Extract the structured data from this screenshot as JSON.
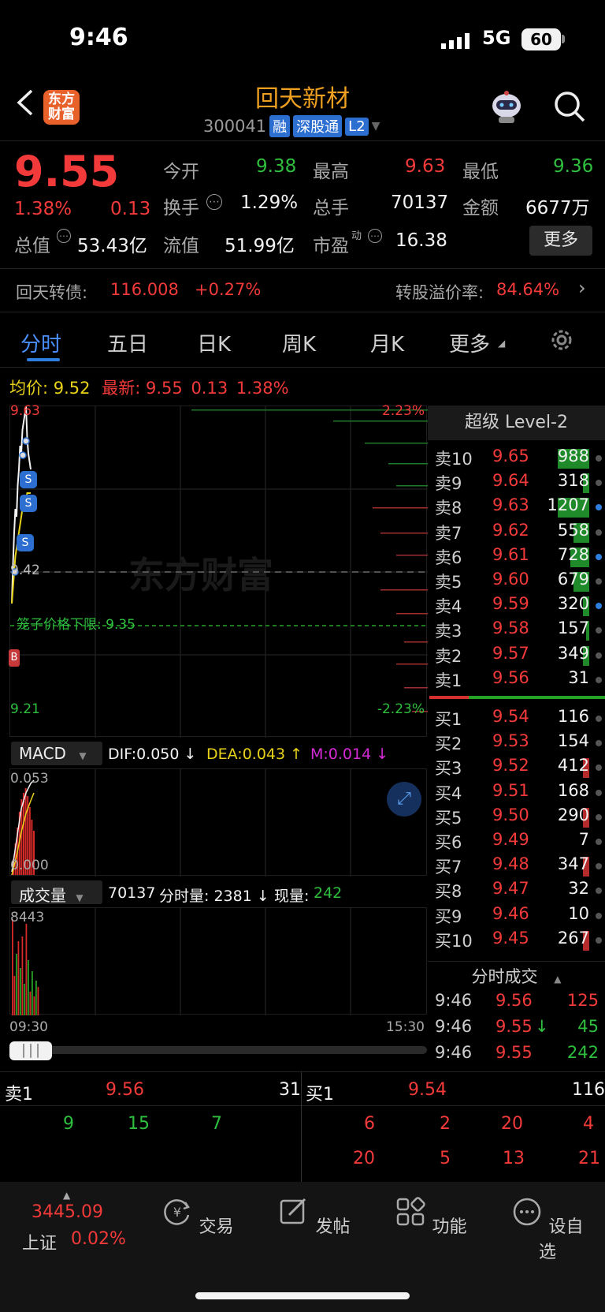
{
  "status": {
    "time": "9:46",
    "network": "5G",
    "battery": "60"
  },
  "header": {
    "title": "回天新材",
    "code": "300041",
    "tags": [
      "融",
      "深股通",
      "L2"
    ],
    "logo_text": "东方财富"
  },
  "quote": {
    "price": "9.55",
    "change_pct": "1.38%",
    "change": "0.13",
    "rows": [
      [
        {
          "k": "今开",
          "v": "9.38",
          "c": "green"
        },
        {
          "k": "最高",
          "v": "9.63",
          "c": "red"
        },
        {
          "k": "最低",
          "v": "9.36",
          "c": "green"
        }
      ],
      [
        {
          "k": "换手",
          "v": "1.29%",
          "c": "white"
        },
        {
          "k": "总手",
          "v": "70137",
          "c": "white"
        },
        {
          "k": "金额",
          "v": "6677万",
          "c": "white"
        }
      ],
      [
        {
          "k": "总值",
          "v": "53.43亿",
          "c": "white"
        },
        {
          "k": "流值",
          "v": "51.99亿",
          "c": "white"
        },
        {
          "k": "市盈",
          "v": "16.38",
          "c": "white"
        }
      ]
    ],
    "pe_sup": "动",
    "more_label": "更多"
  },
  "bond": {
    "name": "回天转债:",
    "price": "116.008",
    "pct": "+0.27%",
    "premium_label": "转股溢价率:",
    "premium": "84.64%"
  },
  "tabs": [
    "分时",
    "五日",
    "日K",
    "周K",
    "月K",
    "更多"
  ],
  "chart": {
    "avg_label": "均价:",
    "avg": "9.52",
    "latest_label": "最新:",
    "latest": "9.55",
    "latest_chg": "0.13",
    "latest_pct": "1.38%",
    "y_top": "9.63",
    "y_mid": "9.42",
    "y_bot": "9.21",
    "pct_top": "2.23%",
    "pct_bot": "-2.23%",
    "limit_label": "笼子价格下限: 9.35",
    "watermark": "东方财富",
    "time_start": "09:30",
    "time_end": "15:30"
  },
  "chart_data": {
    "type": "line",
    "ylim": [
      9.21,
      9.63
    ],
    "x": [
      "09:30",
      "09:31",
      "09:32",
      "09:33",
      "09:34",
      "09:35",
      "09:36",
      "09:37",
      "09:38",
      "09:39",
      "09:40",
      "09:41",
      "09:42",
      "09:43",
      "09:44",
      "09:45",
      "09:46"
    ],
    "series": [
      {
        "values": [
          9.38,
          9.43,
          9.47,
          9.5,
          9.49,
          9.53,
          9.55,
          9.58,
          9.57,
          9.6,
          9.61,
          9.62,
          9.63,
          9.59,
          9.57,
          9.56,
          9.55
        ]
      },
      {
        "values": [
          9.38,
          9.4,
          9.42,
          9.44,
          9.45,
          9.46,
          9.47,
          9.48,
          9.49,
          9.5,
          9.5,
          9.51,
          9.51,
          9.52,
          9.52,
          9.52,
          9.52
        ]
      }
    ]
  },
  "macd": {
    "name": "MACD",
    "dif": "DIF:0.050 ↓",
    "dea": "DEA:0.043 ↑",
    "m": "M:0.014 ↓",
    "top": "0.053",
    "bot": "0.000"
  },
  "volume": {
    "name": "成交量",
    "total": "70137",
    "min_label": "分时量: 2381 ↓",
    "now_label": "现量:",
    "now": "242",
    "top": "8443"
  },
  "level2": {
    "title": "超级 Level-2",
    "asks": [
      {
        "lbl": "卖10",
        "px": "9.65",
        "vol": "988",
        "bar": 1.0,
        "dot": "#555"
      },
      {
        "lbl": "卖9",
        "px": "9.64",
        "vol": "318",
        "bar": 0.2,
        "dot": "#555"
      },
      {
        "lbl": "卖8",
        "px": "9.63",
        "vol": "1207",
        "bar": 1.0,
        "dot": "#2f7fe0"
      },
      {
        "lbl": "卖7",
        "px": "9.62",
        "vol": "558",
        "bar": 0.5,
        "dot": "#555"
      },
      {
        "lbl": "卖6",
        "px": "9.61",
        "vol": "728",
        "bar": 0.6,
        "dot": "#2f7fe0"
      },
      {
        "lbl": "卖5",
        "px": "9.60",
        "vol": "679",
        "bar": 0.5,
        "dot": "#555"
      },
      {
        "lbl": "卖4",
        "px": "9.59",
        "vol": "320",
        "bar": 0.2,
        "dot": "#2f7fe0"
      },
      {
        "lbl": "卖3",
        "px": "9.58",
        "vol": "157",
        "bar": 0.1,
        "dot": "#555"
      },
      {
        "lbl": "卖2",
        "px": "9.57",
        "vol": "349",
        "bar": 0.2,
        "dot": "#555"
      },
      {
        "lbl": "卖1",
        "px": "9.56",
        "vol": "31",
        "bar": 0.0,
        "dot": "#555"
      }
    ],
    "bids": [
      {
        "lbl": "买1",
        "px": "9.54",
        "vol": "116",
        "bar": 0.0,
        "dot": "#555"
      },
      {
        "lbl": "买2",
        "px": "9.53",
        "vol": "154",
        "bar": 0.0,
        "dot": "#555"
      },
      {
        "lbl": "买3",
        "px": "9.52",
        "vol": "412",
        "bar": 0.2,
        "dot": "#555"
      },
      {
        "lbl": "买4",
        "px": "9.51",
        "vol": "168",
        "bar": 0.0,
        "dot": "#555"
      },
      {
        "lbl": "买5",
        "px": "9.50",
        "vol": "290",
        "bar": 0.2,
        "dot": "#555"
      },
      {
        "lbl": "买6",
        "px": "9.49",
        "vol": "7",
        "bar": 0.0,
        "dot": "#555"
      },
      {
        "lbl": "买7",
        "px": "9.48",
        "vol": "347",
        "bar": 0.2,
        "dot": "#555"
      },
      {
        "lbl": "买8",
        "px": "9.47",
        "vol": "32",
        "bar": 0.0,
        "dot": "#555"
      },
      {
        "lbl": "买9",
        "px": "9.46",
        "vol": "10",
        "bar": 0.0,
        "dot": "#555"
      },
      {
        "lbl": "买10",
        "px": "9.45",
        "vol": "267",
        "bar": 0.2,
        "dot": "#555"
      }
    ],
    "ticks_title": "分时成交",
    "ticks": [
      {
        "t": "9:46",
        "p": "9.56",
        "v": "125",
        "vc": "red",
        "arrow": ""
      },
      {
        "t": "9:46",
        "p": "9.55",
        "v": "45",
        "vc": "green",
        "arrow": "↓"
      },
      {
        "t": "9:46",
        "p": "9.55",
        "v": "242",
        "vc": "green",
        "arrow": ""
      }
    ]
  },
  "orderbar": {
    "sell_label": "卖1",
    "sell_px": "9.56",
    "sell_vol": "31",
    "buy_label": "买1",
    "buy_px": "9.54",
    "buy_vol": "116"
  },
  "queue": {
    "sell": [
      "9",
      "15",
      "7"
    ],
    "buy_row1": [
      "6",
      "2",
      "20",
      "4"
    ],
    "buy_row2": [
      "20",
      "5",
      "13",
      "21"
    ]
  },
  "nav": {
    "index_value": "3445.09",
    "index_name": "上证",
    "index_pct": "0.02%",
    "items": [
      "交易",
      "发帖",
      "功能",
      "设自选"
    ]
  }
}
